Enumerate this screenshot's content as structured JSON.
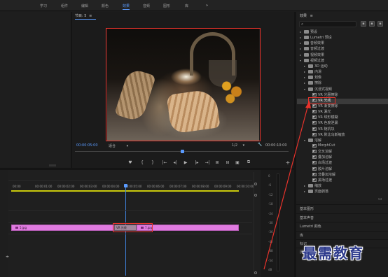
{
  "workspaces": [
    "学习",
    "组件",
    "编辑",
    "颜色",
    "效果",
    "音频",
    "图形",
    "库"
  ],
  "active_workspace": "效果",
  "more_glyph": "»",
  "program_monitor": {
    "title": "节目: 5",
    "menu_glyph": "≡",
    "timecode_current": "00:00:05:00",
    "fit_label": "适合",
    "resolution": "1/2",
    "timecode_end": "00:00:10:00",
    "settings_glyph": "🔧",
    "controls": [
      "♥",
      "{",
      "}",
      "|←",
      "◂|",
      "▶",
      "|▸",
      "→|",
      "⊞",
      "⊟",
      "▣",
      "⧉"
    ],
    "add_glyph": "+"
  },
  "effects_panel": {
    "title": "效果",
    "menu_glyph": "≡",
    "search_glyph": "⌕",
    "tree": [
      {
        "label": "预设",
        "type": "folder",
        "expanded": false,
        "depth": 0
      },
      {
        "label": "Lumetri 预设",
        "type": "folder",
        "expanded": false,
        "depth": 0
      },
      {
        "label": "音频效果",
        "type": "folder",
        "expanded": false,
        "depth": 0
      },
      {
        "label": "音频过渡",
        "type": "folder",
        "expanded": false,
        "depth": 0
      },
      {
        "label": "视频效果",
        "type": "folder",
        "expanded": false,
        "depth": 0
      },
      {
        "label": "视频过渡",
        "type": "folder",
        "expanded": true,
        "depth": 0
      },
      {
        "label": "3D 运动",
        "type": "folder",
        "expanded": false,
        "depth": 1
      },
      {
        "label": "内滑",
        "type": "folder",
        "expanded": false,
        "depth": 1
      },
      {
        "label": "划像",
        "type": "folder",
        "expanded": false,
        "depth": 1
      },
      {
        "label": "擦除",
        "type": "folder",
        "expanded": false,
        "depth": 1
      },
      {
        "label": "沉浸式视频",
        "type": "folder",
        "expanded": true,
        "depth": 1
      },
      {
        "label": "VR 光圈擦除",
        "type": "fx",
        "depth": 2
      },
      {
        "label": "VR 光线",
        "type": "fx",
        "depth": 2
      },
      {
        "label": "VR 渐变擦除",
        "type": "fx",
        "depth": 2
      },
      {
        "label": "VR 漏光",
        "type": "fx",
        "depth": 2
      },
      {
        "label": "VR 球形模糊",
        "type": "fx",
        "depth": 2
      },
      {
        "label": "VR 色度泄漏",
        "type": "fx",
        "depth": 2
      },
      {
        "label": "VR 随机块",
        "type": "fx",
        "depth": 2
      },
      {
        "label": "VR 默比乌斯缩放",
        "type": "fx",
        "depth": 2
      },
      {
        "label": "溶解",
        "type": "folder",
        "expanded": true,
        "depth": 1
      },
      {
        "label": "MorphCut",
        "type": "fx",
        "depth": 2
      },
      {
        "label": "交叉溶解",
        "type": "fx",
        "depth": 2
      },
      {
        "label": "叠加溶解",
        "type": "fx",
        "depth": 2
      },
      {
        "label": "白场过渡",
        "type": "fx",
        "depth": 2
      },
      {
        "label": "胶片溶解",
        "type": "fx",
        "depth": 2
      },
      {
        "label": "非叠加溶解",
        "type": "fx",
        "depth": 2
      },
      {
        "label": "黑场过渡",
        "type": "fx",
        "depth": 2
      },
      {
        "label": "缩放",
        "type": "folder",
        "expanded": false,
        "depth": 1
      },
      {
        "label": "页面剥落",
        "type": "folder",
        "expanded": false,
        "depth": 1
      }
    ],
    "selected_index": 12,
    "new_folder_glyph": "▭",
    "sections": [
      "基本图形",
      "基本声音",
      "Lumetri 颜色",
      "库",
      "标记",
      "历史记录"
    ]
  },
  "timeline": {
    "ruler": [
      "00:00",
      "00:00:01:00",
      "00:00:02:00",
      "00:00:03:00",
      "00:00:04:00",
      "00:00:05:00",
      "00:00:06:00",
      "00:00:07:00",
      "00:00:08:00",
      "00:00:09:00",
      "00:00:10:00"
    ],
    "clip1": "5.jpg",
    "transition": "VR 光线",
    "clip2": "7.jpg",
    "playhead_fraction": 0.5
  },
  "audio_meter": {
    "labels": [
      "0",
      "-6",
      "-12",
      "-18",
      "-24",
      "-30",
      "-36",
      "-42",
      "-48",
      "-54",
      "dB"
    ]
  },
  "logo_text": "最需教育",
  "colors": {
    "accent": "#5a9bff",
    "highlight": "#e8332c",
    "clip": "#e07be0"
  }
}
